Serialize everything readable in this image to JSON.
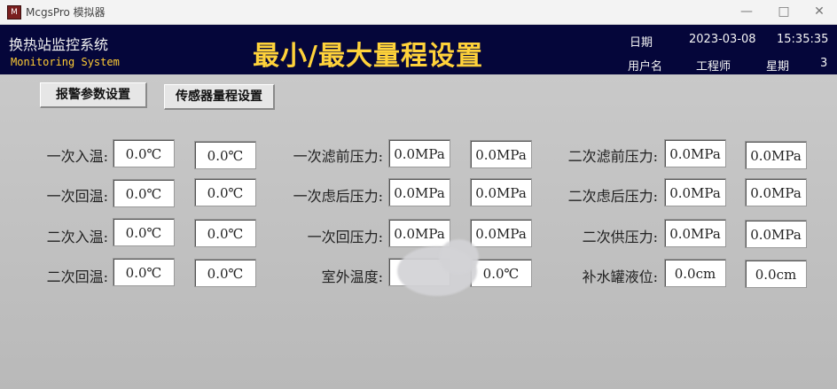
{
  "window": {
    "title": "McgsPro 模拟器",
    "minimize": "—",
    "maximize": "□",
    "close": "✕"
  },
  "header": {
    "system_name": "换热站监控系统",
    "system_name_en": "Monitoring System",
    "page_title": "最小/最大量程设置",
    "date_label": "日期",
    "date_value": "2023-03-08",
    "time_value": "15:35:35",
    "user_label": "用户名",
    "user_value": "工程师",
    "weekday_label": "星期",
    "weekday_value": "3"
  },
  "tabs": [
    "报警参数设置",
    "传感器量程设置"
  ],
  "columns": [
    {
      "rows": [
        {
          "label": "一次入温:",
          "min": "0.0℃",
          "max": "0.0℃"
        },
        {
          "label": "一次回温:",
          "min": "0.0℃",
          "max": "0.0℃"
        },
        {
          "label": "二次入温:",
          "min": "0.0℃",
          "max": "0.0℃"
        },
        {
          "label": "二次回温:",
          "min": "0.0℃",
          "max": "0.0℃"
        }
      ]
    },
    {
      "rows": [
        {
          "label": "一次滤前压力:",
          "min": "0.0MPa",
          "max": "0.0MPa"
        },
        {
          "label": "一次虑后压力:",
          "min": "0.0MPa",
          "max": "0.0MPa"
        },
        {
          "label": "一次回压力:",
          "min": "0.0MPa",
          "max": "0.0MPa"
        },
        {
          "label": "室外温度:",
          "min": "",
          "max": "0.0℃"
        }
      ]
    },
    {
      "rows": [
        {
          "label": "二次滤前压力:",
          "min": "0.0MPa",
          "max": "0.0MPa"
        },
        {
          "label": "二次虑后压力:",
          "min": "0.0MPa",
          "max": "0.0MPa"
        },
        {
          "label": "二次供压力:",
          "min": "0.0MPa",
          "max": "0.0MPa"
        },
        {
          "label": "补水罐液位:",
          "min": "0.0cm",
          "max": "0.0cm"
        }
      ]
    }
  ]
}
